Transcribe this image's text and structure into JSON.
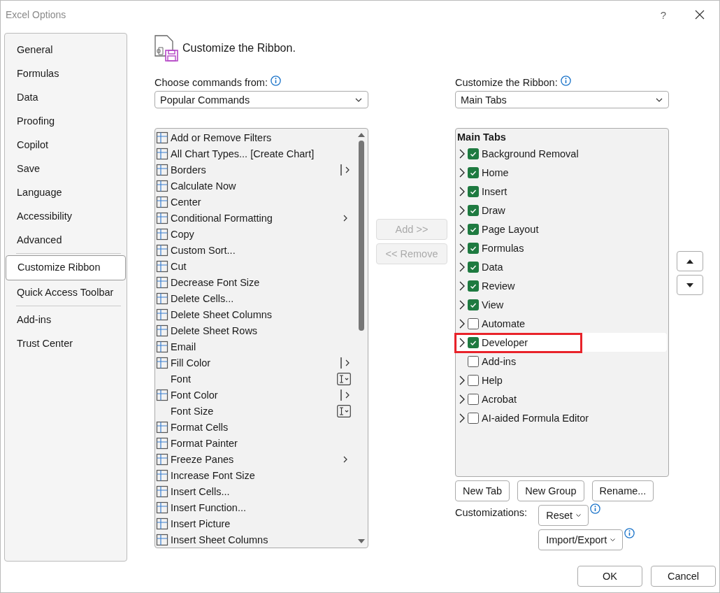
{
  "window": {
    "title": "Excel Options",
    "help": "?"
  },
  "sidebar": {
    "groups": [
      [
        {
          "label": "General",
          "selected": false
        },
        {
          "label": "Formulas",
          "selected": false
        },
        {
          "label": "Data",
          "selected": false
        },
        {
          "label": "Proofing",
          "selected": false
        },
        {
          "label": "Copilot",
          "selected": false
        },
        {
          "label": "Save",
          "selected": false
        },
        {
          "label": "Language",
          "selected": false
        },
        {
          "label": "Accessibility",
          "selected": false
        },
        {
          "label": "Advanced",
          "selected": false
        }
      ],
      [
        {
          "label": "Customize Ribbon",
          "selected": true
        },
        {
          "label": "Quick Access Toolbar",
          "selected": false
        }
      ],
      [
        {
          "label": "Add-ins",
          "selected": false
        },
        {
          "label": "Trust Center",
          "selected": false
        }
      ]
    ]
  },
  "heading": "Customize the Ribbon.",
  "commands_from": {
    "label": "Choose commands from:",
    "value": "Popular Commands"
  },
  "commands": [
    {
      "label": "Add or Remove Filters",
      "has_icon": true,
      "kind": "plain"
    },
    {
      "label": "All Chart Types... [Create Chart]",
      "has_icon": true,
      "kind": "plain"
    },
    {
      "label": "Borders",
      "has_icon": true,
      "kind": "split"
    },
    {
      "label": "Calculate Now",
      "has_icon": true,
      "kind": "plain"
    },
    {
      "label": "Center",
      "has_icon": true,
      "kind": "plain"
    },
    {
      "label": "Conditional Formatting",
      "has_icon": true,
      "kind": "submenu"
    },
    {
      "label": "Copy",
      "has_icon": true,
      "kind": "plain"
    },
    {
      "label": "Custom Sort...",
      "has_icon": true,
      "kind": "plain"
    },
    {
      "label": "Cut",
      "has_icon": true,
      "kind": "plain"
    },
    {
      "label": "Decrease Font Size",
      "has_icon": true,
      "kind": "plain"
    },
    {
      "label": "Delete Cells...",
      "has_icon": true,
      "kind": "plain"
    },
    {
      "label": "Delete Sheet Columns",
      "has_icon": true,
      "kind": "plain"
    },
    {
      "label": "Delete Sheet Rows",
      "has_icon": true,
      "kind": "plain"
    },
    {
      "label": "Email",
      "has_icon": true,
      "kind": "plain"
    },
    {
      "label": "Fill Color",
      "has_icon": true,
      "kind": "split"
    },
    {
      "label": "Font",
      "has_icon": false,
      "kind": "combo"
    },
    {
      "label": "Font Color",
      "has_icon": true,
      "kind": "split"
    },
    {
      "label": "Font Size",
      "has_icon": false,
      "kind": "combo"
    },
    {
      "label": "Format Cells",
      "has_icon": true,
      "kind": "plain"
    },
    {
      "label": "Format Painter",
      "has_icon": true,
      "kind": "plain"
    },
    {
      "label": "Freeze Panes",
      "has_icon": true,
      "kind": "submenu"
    },
    {
      "label": "Increase Font Size",
      "has_icon": true,
      "kind": "plain"
    },
    {
      "label": "Insert Cells...",
      "has_icon": true,
      "kind": "plain"
    },
    {
      "label": "Insert Function...",
      "has_icon": true,
      "kind": "plain"
    },
    {
      "label": "Insert Picture",
      "has_icon": true,
      "kind": "plain"
    },
    {
      "label": "Insert Sheet Columns",
      "has_icon": true,
      "kind": "plain"
    }
  ],
  "move_buttons": [
    {
      "label": "Add >>",
      "disabled": true
    },
    {
      "label": "<< Remove",
      "disabled": true
    }
  ],
  "customize_ribbon": {
    "label": "Customize the Ribbon:",
    "value": "Main Tabs"
  },
  "tree": {
    "header": "Main Tabs",
    "items": [
      {
        "label": "Background Removal",
        "expandable": true,
        "checked": true,
        "selected": false,
        "highlighted": false
      },
      {
        "label": "Home",
        "expandable": true,
        "checked": true,
        "selected": false,
        "highlighted": false
      },
      {
        "label": "Insert",
        "expandable": true,
        "checked": true,
        "selected": false,
        "highlighted": false
      },
      {
        "label": "Draw",
        "expandable": true,
        "checked": true,
        "selected": false,
        "highlighted": false
      },
      {
        "label": "Page Layout",
        "expandable": true,
        "checked": true,
        "selected": false,
        "highlighted": false
      },
      {
        "label": "Formulas",
        "expandable": true,
        "checked": true,
        "selected": false,
        "highlighted": false
      },
      {
        "label": "Data",
        "expandable": true,
        "checked": true,
        "selected": false,
        "highlighted": false
      },
      {
        "label": "Review",
        "expandable": true,
        "checked": true,
        "selected": false,
        "highlighted": false
      },
      {
        "label": "View",
        "expandable": true,
        "checked": true,
        "selected": false,
        "highlighted": false
      },
      {
        "label": "Automate",
        "expandable": true,
        "checked": false,
        "selected": false,
        "highlighted": false
      },
      {
        "label": "Developer",
        "expandable": true,
        "checked": true,
        "selected": true,
        "highlighted": true
      },
      {
        "label": "Add-ins",
        "expandable": false,
        "checked": false,
        "selected": false,
        "highlighted": false
      },
      {
        "label": "Help",
        "expandable": true,
        "checked": false,
        "selected": false,
        "highlighted": false
      },
      {
        "label": "Acrobat",
        "expandable": true,
        "checked": false,
        "selected": false,
        "highlighted": false
      },
      {
        "label": "AI-aided Formula Editor",
        "expandable": true,
        "checked": false,
        "selected": false,
        "highlighted": false
      }
    ]
  },
  "tree_buttons": [
    "New Tab",
    "New Group",
    "Rename..."
  ],
  "customizations": {
    "label": "Customizations:",
    "reset": "Reset",
    "import_export": "Import/Export"
  },
  "footer_buttons": [
    "OK",
    "Cancel"
  ]
}
